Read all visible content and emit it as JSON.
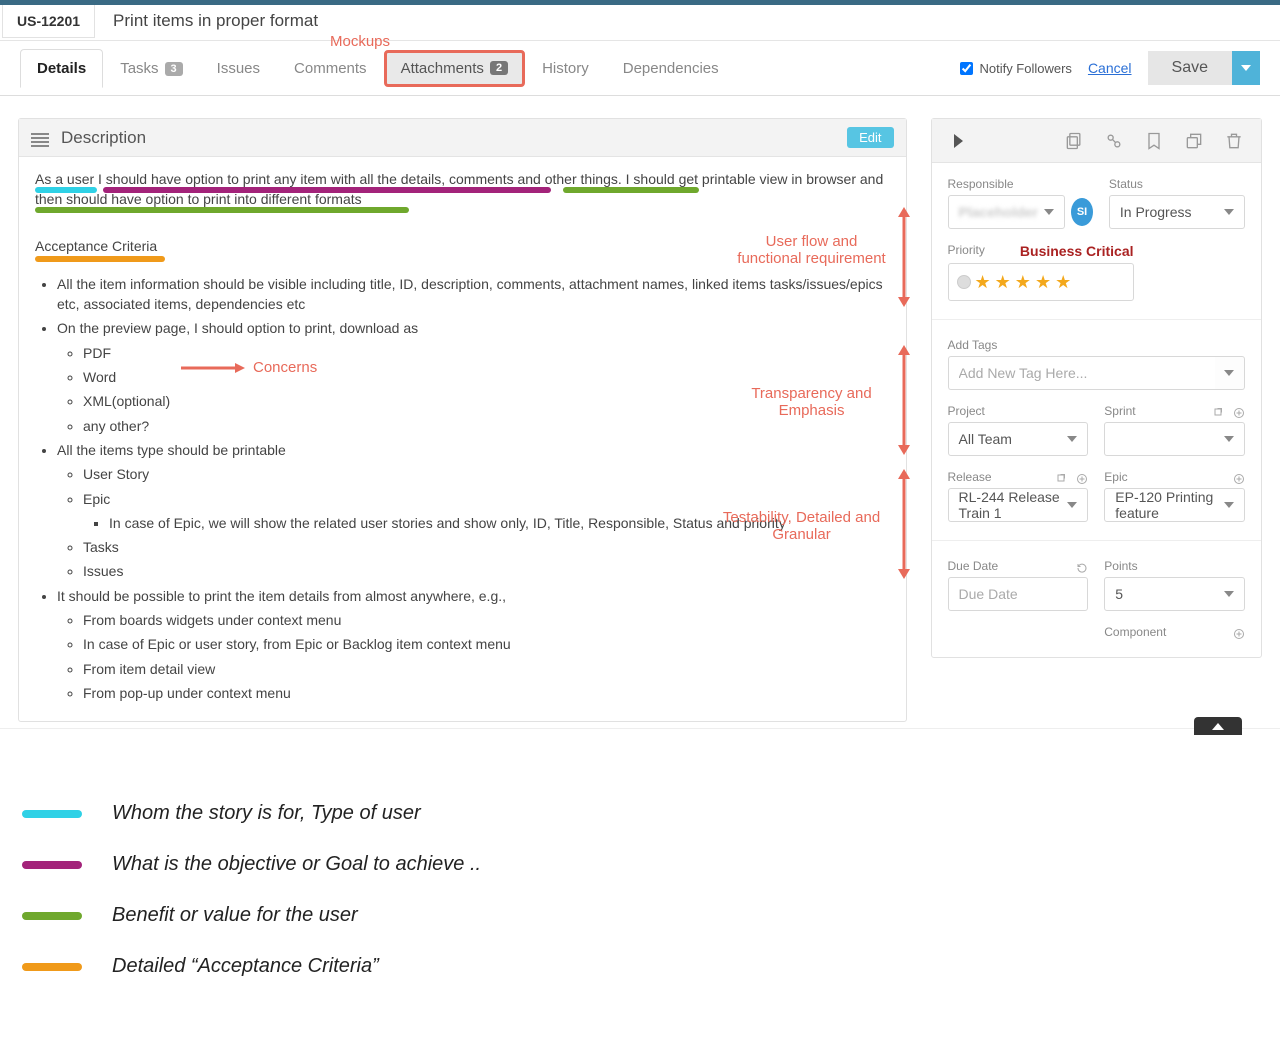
{
  "item": {
    "id": "US-12201",
    "title": "Print items in proper format"
  },
  "annotations": {
    "mockups": "Mockups",
    "userflow": "User flow and functional requirement",
    "concerns": "Concerns",
    "transparency": "Transparency and Emphasis",
    "testability": "Testability, Detailed and Granular"
  },
  "tabs": [
    {
      "label": "Details",
      "active": true
    },
    {
      "label": "Tasks",
      "badge": "3"
    },
    {
      "label": "Issues"
    },
    {
      "label": "Comments"
    },
    {
      "label": "Attachments",
      "badge": "2",
      "highlighted": true
    },
    {
      "label": "History"
    },
    {
      "label": "Dependencies"
    }
  ],
  "actions": {
    "notify_label": "Notify Followers",
    "notify_checked": true,
    "cancel": "Cancel",
    "save": "Save"
  },
  "description": {
    "section_label": "Description",
    "edit": "Edit",
    "story": "As a user I should have option to print any item with all the details, comments and other things. I should get printable view in browser and then should have option to print into different formats",
    "ac_heading": "Acceptance Criteria",
    "bullets": {
      "b0": "All the item information should be visible including title, ID, description, comments, attachment names, linked items tasks/issues/epics etc, associated items, dependencies etc",
      "b1": "On the preview page, I should option to print, download as",
      "b1s": {
        "a": "PDF",
        "b": "Word",
        "c": "XML(optional)",
        "d": "any other?"
      },
      "b2": "All the items type should be printable",
      "b2s": {
        "a": "User Story",
        "b": "Epic",
        "b_sub": "In case of Epic, we will show the related user stories and show only, ID, Title, Responsible, Status and priority",
        "c": "Tasks",
        "d": "Issues"
      },
      "b3": "It should be possible to print the item details from almost anywhere, e.g.,",
      "b3s": {
        "a": "From boards widgets under context menu",
        "b": "In case of Epic or user story, from Epic or Backlog item context menu",
        "c": "From item detail view",
        "d": "From pop-up under context menu"
      }
    }
  },
  "side": {
    "responsible": {
      "label": "Responsible",
      "value": "Placeholder",
      "badge": "SI"
    },
    "status": {
      "label": "Status",
      "value": "In Progress"
    },
    "priority": {
      "label": "Priority",
      "right_label": "Business Critical",
      "stars": 5
    },
    "tags": {
      "label": "Add Tags",
      "placeholder": "Add New Tag Here..."
    },
    "project": {
      "label": "Project",
      "value": "All Team"
    },
    "sprint": {
      "label": "Sprint",
      "value": ""
    },
    "release": {
      "label": "Release",
      "value": "RL-244 Release Train 1"
    },
    "epic": {
      "label": "Epic",
      "value": "EP-120 Printing feature"
    },
    "due": {
      "label": "Due Date",
      "placeholder": "Due Date"
    },
    "points": {
      "label": "Points",
      "value": "5"
    },
    "component": {
      "label": "Component"
    }
  },
  "legend": {
    "cyan": "Whom the story is for, Type of user",
    "purple": "What is the objective or Goal to achieve ..",
    "green": "Benefit or value for the user",
    "orange": "Detailed “Acceptance Criteria”"
  }
}
